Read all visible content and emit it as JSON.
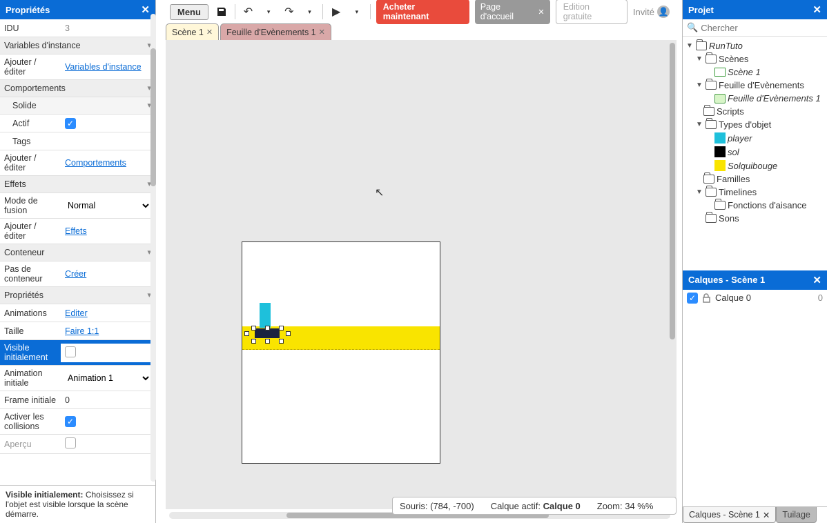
{
  "left": {
    "title": "Propriétés",
    "idu_label": "IDU",
    "idu_value": "3",
    "sec_vars": "Variables d'instance",
    "add_edit": "Ajouter / éditer",
    "link_vars": "Variables d'instance",
    "sec_behav": "Comportements",
    "solid": "Solide",
    "active": "Actif",
    "tags": "Tags",
    "link_behav": "Comportements",
    "sec_effects": "Effets",
    "blend": "Mode de fusion",
    "blend_val": "Normal",
    "link_effects": "Effets",
    "sec_container": "Conteneur",
    "no_container": "Pas de conteneur",
    "link_create": "Créer",
    "sec_props": "Propriétés",
    "anim": "Animations",
    "link_edit": "Editer",
    "size": "Taille",
    "link_size": "Faire 1:1",
    "visible": "Visible initialement",
    "anim_init": "Animation initiale",
    "anim_init_val": "Animation 1",
    "frame_init": "Frame initiale",
    "frame_init_val": "0",
    "collisions": "Activer les collisions",
    "preview": "Aperçu",
    "help_title": "Visible initialement:",
    "help_body": "Choisissez si l'objet est visible lorsque la scène démarre."
  },
  "toolbar": {
    "menu": "Menu",
    "buy": "Acheter maintenant",
    "home": "Page d'accueil",
    "free": "Edition gratuite",
    "guest": "Invité"
  },
  "tabs": {
    "scene": "Scène 1",
    "events": "Feuille d'Evènements 1"
  },
  "status": {
    "mouse_label": "Souris:",
    "mouse_val": "(784, -700)",
    "layer_label": "Calque actif:",
    "layer_val": "Calque 0",
    "zoom_label": "Zoom:",
    "zoom_val": "34 %%"
  },
  "project": {
    "title": "Projet",
    "search": "Chercher",
    "root": "RunTuto",
    "scenes": "Scènes",
    "scene1": "Scène 1",
    "sheets": "Feuille d'Evènements",
    "sheet1": "Feuille d'Evènements 1",
    "scripts": "Scripts",
    "objtypes": "Types d'objet",
    "player": "player",
    "sol": "sol",
    "solqui": "Solquibouge",
    "families": "Familles",
    "timelines": "Timelines",
    "ease": "Fonctions d'aisance",
    "sounds": "Sons"
  },
  "layers": {
    "title": "Calques - Scène 1",
    "layer0": "Calque 0",
    "count": "0",
    "tab1": "Calques - Scène 1",
    "tab2": "Tuilage"
  }
}
